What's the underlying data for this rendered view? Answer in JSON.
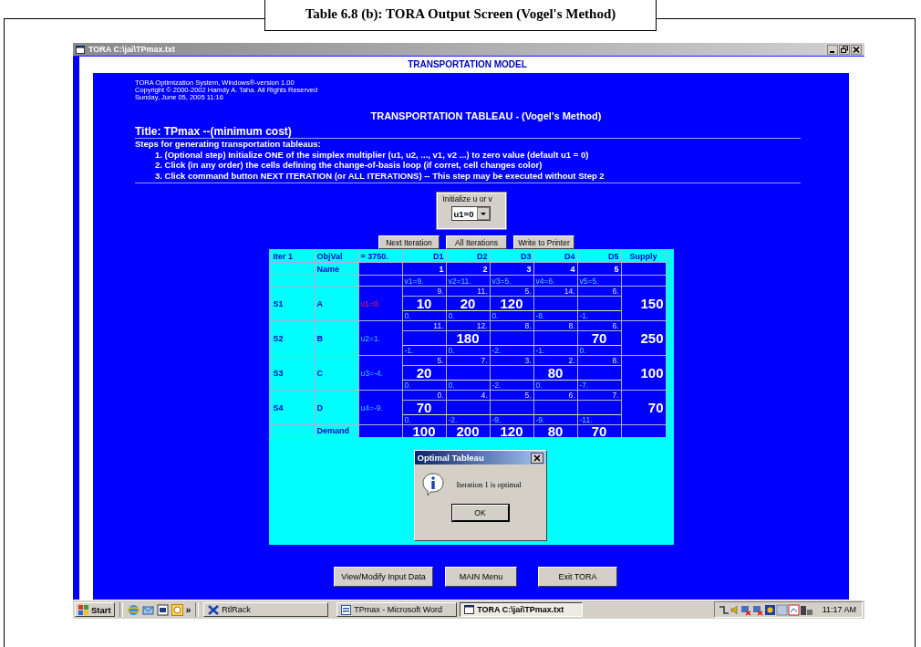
{
  "caption": "Table 6.8 (b): TORA Output Screen (Vogel's Method)",
  "window": {
    "title": "TORA  C:\\jai\\TPmax.txt"
  },
  "header": "TRANSPORTATION MODEL",
  "info_lines": [
    "TORA Optimization System, Windows®-version 1.00",
    "Copyright © 2000-2002 Hamdy A. Taha. All Rights Reserved",
    "Sunday, June 05, 2005 11:16"
  ],
  "tableau_title": "TRANSPORTATION TABLEAU - (Vogel's Method)",
  "problem_title": "Title: TPmax --(minimum cost)",
  "steps_heading": "Steps for generating transportation tableaus:",
  "steps": [
    "1.  (Optional step) Initialize ONE of the simplex multiplier (u1, u2, ..., v1, v2 ...) to zero value (default u1 = 0)",
    "2.  Click (in any order) the cells defining the change-of-basis loop (if corret, cell changes color)",
    "3.  Click command button NEXT ITERATION (or ALL ITERATIONS) -- This step may be executed without Step 2"
  ],
  "initialize": {
    "label": "Initialize u or v",
    "value": "u1=0"
  },
  "action_buttons": [
    "Next Iteration",
    "All Iterations",
    "Write to Printer"
  ],
  "tableau": {
    "iter": "Iter 1",
    "objval_label": "ObjVal",
    "objval": "= 3750.",
    "destinations": [
      "D1",
      "D2",
      "D3",
      "D4",
      "D5"
    ],
    "supply_label": "Supply",
    "name_label": "Name",
    "dest_names": [
      "1",
      "2",
      "3",
      "4",
      "5"
    ],
    "v_values": [
      "v1=9.",
      "v2=11.",
      "v3=5.",
      "v4=6.",
      "v5=5."
    ],
    "rows": [
      {
        "source": "S1",
        "name": "A",
        "u": "u1=0.",
        "initialized": true,
        "supply": "150",
        "cells": [
          {
            "cost": "9.",
            "amount": "10",
            "reduced": "0."
          },
          {
            "cost": "11.",
            "amount": "20",
            "reduced": "0."
          },
          {
            "cost": "5.",
            "amount": "120",
            "reduced": "0."
          },
          {
            "cost": "14.",
            "reduced": "-8."
          },
          {
            "cost": "6.",
            "reduced": "-1."
          }
        ]
      },
      {
        "source": "S2",
        "name": "B",
        "u": "u2=1.",
        "initialized": false,
        "supply": "250",
        "cells": [
          {
            "cost": "11.",
            "reduced": "-1."
          },
          {
            "cost": "12.",
            "amount": "180",
            "reduced": "0."
          },
          {
            "cost": "8.",
            "reduced": "-2."
          },
          {
            "cost": "8.",
            "reduced": "-1."
          },
          {
            "cost": "6.",
            "amount": "70",
            "reduced": "0."
          }
        ]
      },
      {
        "source": "S3",
        "name": "C",
        "u": "u3=-4.",
        "initialized": false,
        "supply": "100",
        "cells": [
          {
            "cost": "5.",
            "amount": "20",
            "reduced": "0."
          },
          {
            "cost": "7.",
            "reduced": "0."
          },
          {
            "cost": "3.",
            "reduced": "-2."
          },
          {
            "cost": "2.",
            "amount": "80",
            "reduced": "0."
          },
          {
            "cost": "8.",
            "reduced": "-7."
          }
        ]
      },
      {
        "source": "S4",
        "name": "D",
        "u": "u4=-9.",
        "initialized": false,
        "supply": "70",
        "cells": [
          {
            "cost": "0.",
            "amount": "70",
            "reduced": "0."
          },
          {
            "cost": "4.",
            "reduced": "-2."
          },
          {
            "cost": "5.",
            "reduced": "-9."
          },
          {
            "cost": "6.",
            "reduced": "-9."
          },
          {
            "cost": "7.",
            "reduced": "-11."
          }
        ]
      }
    ],
    "demand_label": "Demand",
    "demand": [
      "100",
      "200",
      "120",
      "80",
      "70"
    ]
  },
  "dialog": {
    "title": "Optimal Tableau",
    "message": "Iteration 1 is optimal",
    "button": "OK"
  },
  "bottom_buttons": [
    "View/Modify Input Data",
    "MAIN Menu",
    "Exit TORA"
  ],
  "taskbar": {
    "start": "Start",
    "more": "»",
    "tasks": [
      {
        "label": "RtlRack",
        "selected": false
      },
      {
        "label": "TPmax - Microsoft Word",
        "selected": false
      },
      {
        "label": "TORA  C:\\jai\\TPmax.txt",
        "selected": true
      }
    ],
    "clock": "11:17 AM"
  }
}
